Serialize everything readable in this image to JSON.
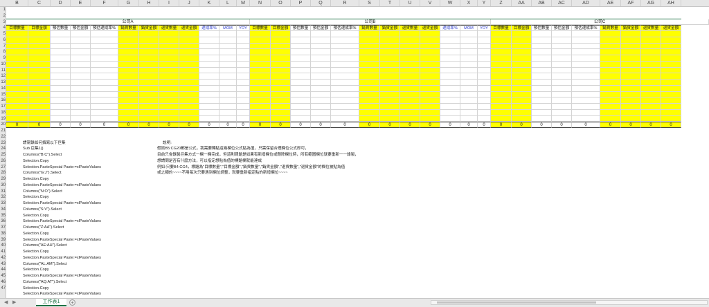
{
  "columns": [
    "B",
    "C",
    "D",
    "E",
    "F",
    "G",
    "H",
    "I",
    "J",
    "K",
    "L",
    "M",
    "N",
    "O",
    "P",
    "Q",
    "R",
    "S",
    "T",
    "U",
    "V",
    "W",
    "X",
    "Y",
    "Z",
    "AA",
    "AB",
    "AC",
    "AD",
    "AE",
    "AF",
    "AG",
    "AH"
  ],
  "row_numbers": [
    "1",
    "2",
    "3",
    "4",
    "5",
    "6",
    "7",
    "8",
    "9",
    "10",
    "11",
    "12",
    "13",
    "14",
    "15",
    "16",
    "17",
    "18",
    "19",
    "20",
    "21",
    "22",
    "23",
    "24",
    "25",
    "26",
    "27",
    "28",
    "29",
    "30",
    "31",
    "32",
    "33",
    "34",
    "35",
    "36",
    "37",
    "38",
    "39",
    "40",
    "41",
    "42",
    "43",
    "44",
    "45",
    "46",
    "47"
  ],
  "company_labels": [
    "公司A",
    "公司B",
    "公司C"
  ],
  "headers": [
    "目標數量",
    "目標金額",
    "預估數量",
    "預估金額",
    "預估達成率%",
    "銷貨數量",
    "銷貨金額",
    "退貨數量",
    "退貨金額",
    "達成率%",
    "MOM",
    "YOY",
    "目標數量",
    "目標金額",
    "預估數量",
    "預估金額",
    "預估達成率%",
    "銷貨數量",
    "銷貨金額",
    "退貨數量",
    "退貨金額",
    "達成率%",
    "MOM",
    "YOY",
    "目標數量",
    "目標金額",
    "預估數量",
    "預估金額",
    "預估達成率%",
    "銷貨數量",
    "銷貨金額",
    "退貨數量",
    "退貨金額",
    "達"
  ],
  "totals": [
    "0",
    "0",
    "0",
    "0",
    "0",
    "0",
    "0",
    "0",
    "0",
    "0",
    "0",
    "0",
    "0",
    "0",
    "0",
    "0",
    "0",
    "0",
    "0",
    "0",
    "0",
    "0",
    "0",
    "0",
    "0",
    "0",
    "0",
    "0",
    "0",
    "0",
    "0",
    "0",
    "0"
  ],
  "macro_lines": [
    "請幫錄如何撰寫以下巨集",
    "Sub 巨集1()",
    "    Columns(\"B:C\").Select",
    "    Selection.Copy",
    "    Selection.PasteSpecial Paste:=xlPasteValues",
    "    Columns(\"G:J\").Select",
    "    Selection.Copy",
    "    Selection.PasteSpecial Paste:=xlPasteValues",
    "    Columns(\"N:O\").Select",
    "    Selection.Copy",
    "    Selection.PasteSpecial Paste:=xlPasteValues",
    "    Columns(\"S:V\").Select",
    "    Selection.Copy",
    "    Selection.PasteSpecial Paste:=xlPasteValues",
    "    Columns(\"Z:AA\").Select",
    "    Selection.Copy",
    "    Selection.PasteSpecial Paste:=xlPasteValues",
    "    Columns(\"AE:AH\").Select",
    "    Selection.Copy",
    "    Selection.PasteSpecial Paste:=xlPasteValues",
    "    Columns(\"AL:AM\").Select",
    "    Selection.Copy",
    "    Selection.PasteSpecial Paste:=xlPasteValues",
    "    Columns(\"AQ:AT\").Select",
    "    Selection.Copy",
    "    Selection.PasteSpecial Paste:=xlPasteValues",
    "    Columns(\"AX:AY\").Select"
  ],
  "notes_lines": [
    "說明:",
    "假設B5:CG20都是公式，我需要轉貼這幾欄位公式貼為值，只需保留合理欄位公式即可，",
    "目前只會錄製巨集方式一欄一欄完成，但這則問題是如果有新增欄位或刪除欄位時，所有範圍欄位就要重新一一錄製，",
    "想請問是否有什麼方法，可以指定想貼為值的標題欄就能達成",
    "例如:只要B4:CG4，標題為\"目標數量\",\"目標金額\",\"銷貨數量\",\"銷貨金額\",\"退貨數量\",\"退貨金額\"的欄位被貼為值",
    "或之類的~~~~不用每次只要遇到欄位調整，就要重新指定貼的新增欄位~~~~"
  ],
  "sheet_tab": "工作表1",
  "colors": {
    "highlight": "#ffff00",
    "blue_header": "#2f3fd0",
    "green_accent": "#217346",
    "highlight_border": "#c8c800"
  }
}
